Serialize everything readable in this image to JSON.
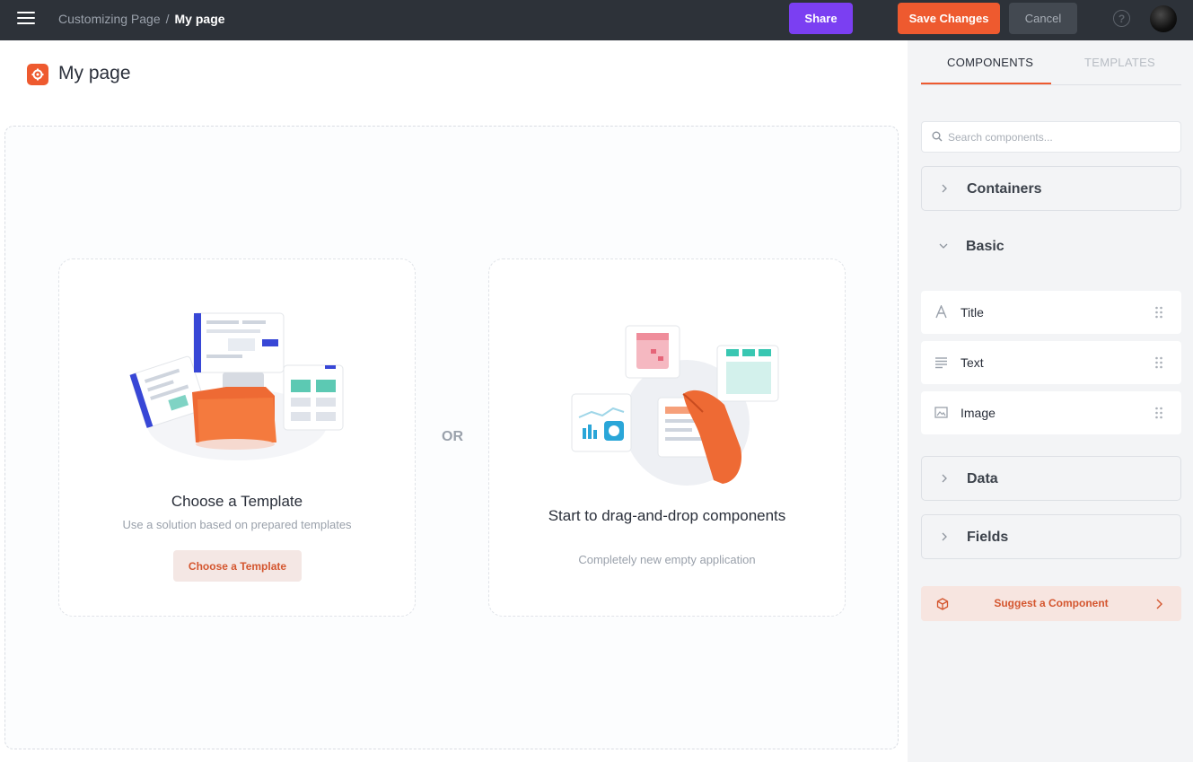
{
  "topbar": {
    "breadcrumb": {
      "parent": "Customizing Page",
      "separator": "/",
      "current": "My page"
    },
    "share_label": "Share",
    "save_label": "Save Changes",
    "cancel_label": "Cancel",
    "help_glyph": "?"
  },
  "page": {
    "title": "My page",
    "icon": "gear-icon"
  },
  "canvas": {
    "template_card": {
      "title": "Choose a Template",
      "subtitle": "Use a solution based on prepared templates",
      "button_label": "Choose a Template"
    },
    "or_label": "OR",
    "dnd_card": {
      "title": "Start to drag-and-drop components",
      "subtitle": "Completely new empty application"
    }
  },
  "panel": {
    "tabs": [
      {
        "label": "COMPONENTS",
        "active": true
      },
      {
        "label": "TEMPLATES",
        "active": false
      }
    ],
    "search_placeholder": "Search components...",
    "sections": [
      {
        "label": "Containers",
        "expanded": false
      },
      {
        "label": "Basic",
        "expanded": true
      },
      {
        "label": "Data",
        "expanded": false
      },
      {
        "label": "Fields",
        "expanded": false
      }
    ],
    "basic_items": [
      {
        "label": "Title",
        "icon": "title-icon"
      },
      {
        "label": "Text",
        "icon": "text-lines-icon"
      },
      {
        "label": "Image",
        "icon": "image-icon"
      }
    ],
    "suggest_label": "Suggest a Component"
  },
  "colors": {
    "accent": "#ee5a2f",
    "share": "#7b3ff2",
    "topbar": "#2d3239",
    "panel": "#f3f4f6"
  }
}
